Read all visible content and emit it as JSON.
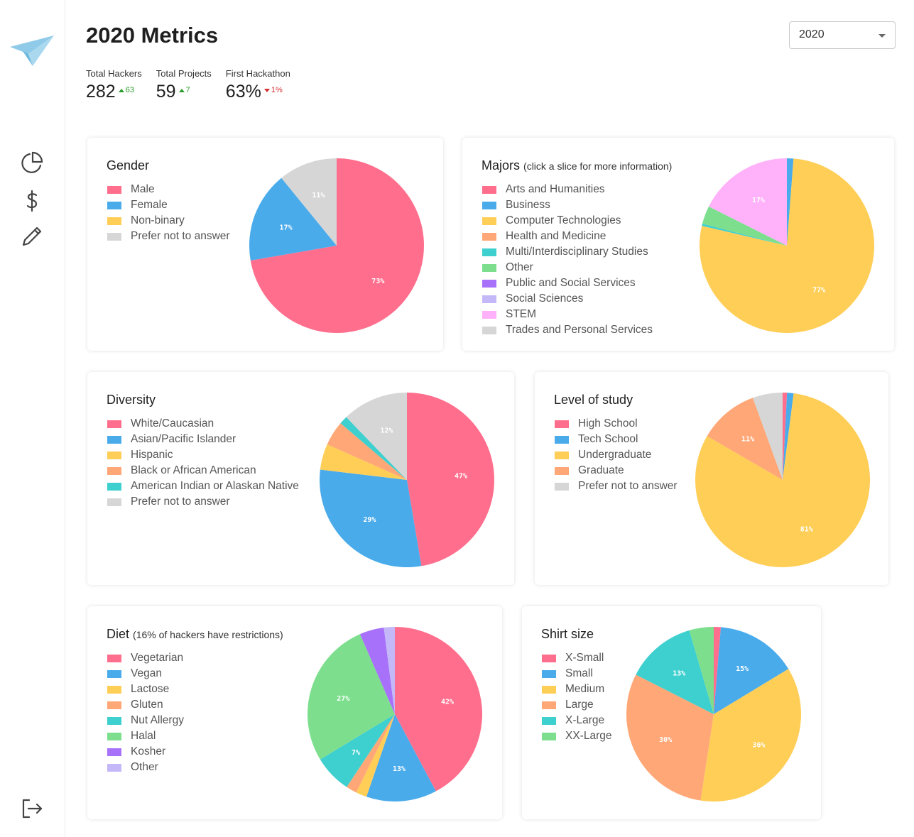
{
  "page": {
    "title": "2020 Metrics"
  },
  "year_select": {
    "value": "2020"
  },
  "stats": [
    {
      "label": "Total Hackers",
      "value": "282",
      "delta": "63",
      "direction": "up"
    },
    {
      "label": "Total Projects",
      "value": "59",
      "delta": "7",
      "direction": "up"
    },
    {
      "label": "First Hackathon",
      "value": "63%",
      "delta": "1%",
      "direction": "down"
    }
  ],
  "colors": {
    "pink": "#ff6f8d",
    "blue": "#4aabeb",
    "yellow": "#ffce57",
    "orange": "#ffa776",
    "teal": "#3ecfcf",
    "green": "#7ddf8d",
    "purple": "#a772f9",
    "lavender": "#c4b8f8",
    "magenta": "#ffb1f9",
    "gray": "#d6d6d6"
  },
  "cards": {
    "gender": {
      "title": "Gender",
      "note": ""
    },
    "majors": {
      "title": "Majors",
      "note": "(click a slice for more information)"
    },
    "diversity": {
      "title": "Diversity",
      "note": ""
    },
    "level": {
      "title": "Level of study",
      "note": ""
    },
    "diet": {
      "title": "Diet",
      "note": "(16% of hackers have restrictions)"
    },
    "shirt": {
      "title": "Shirt size",
      "note": ""
    }
  },
  "chart_data": [
    {
      "id": "gender",
      "type": "pie",
      "labels": [
        "Male",
        "Female",
        "Non-binary",
        "Prefer not to answer"
      ],
      "values": [
        73,
        17,
        0,
        11
      ],
      "colors": [
        "#ff6f8d",
        "#4aabeb",
        "#ffce57",
        "#d6d6d6"
      ],
      "shown_labels": [
        "73%",
        "17%",
        "",
        "11%"
      ]
    },
    {
      "id": "majors",
      "type": "pie",
      "labels": [
        "Arts and Humanities",
        "Business",
        "Computer Technologies",
        "Health and Medicine",
        "Multi/Interdisciplinary Studies",
        "Other",
        "Public and Social Services",
        "Social Sciences",
        "STEM",
        "Trades and Personal Services"
      ],
      "values": [
        0,
        1.2,
        76.5,
        0,
        0.4,
        3.3,
        0,
        0,
        17.4,
        0
      ],
      "colors": [
        "#ff6f8d",
        "#4aabeb",
        "#ffce57",
        "#ffa776",
        "#3ecfcf",
        "#7ddf8d",
        "#a772f9",
        "#c4b8f8",
        "#ffb1f9",
        "#d6d6d6"
      ],
      "shown_labels": [
        "",
        "",
        "77%",
        "",
        "",
        "",
        "",
        "",
        "17%",
        ""
      ]
    },
    {
      "id": "diversity",
      "type": "pie",
      "labels": [
        "White/Caucasian",
        "Asian/Pacific Islander",
        "Hispanic",
        "Black or African American",
        "American Indian or Alaskan Native",
        "Prefer not to answer"
      ],
      "values": [
        46.5,
        29,
        4.7,
        4.5,
        1.5,
        12
      ],
      "colors": [
        "#ff6f8d",
        "#4aabeb",
        "#ffce57",
        "#ffa776",
        "#3ecfcf",
        "#d6d6d6"
      ],
      "shown_labels": [
        "47%",
        "29%",
        "",
        "",
        "",
        "12%"
      ]
    },
    {
      "id": "level",
      "type": "pie",
      "labels": [
        "High School",
        "Tech School",
        "Undergraduate",
        "Graduate",
        "Prefer not to answer"
      ],
      "values": [
        0.8,
        1.2,
        80.7,
        11,
        5.5
      ],
      "colors": [
        "#ff6f8d",
        "#4aabeb",
        "#ffce57",
        "#ffa776",
        "#d6d6d6"
      ],
      "shown_labels": [
        "",
        "",
        "81%",
        "11%",
        ""
      ]
    },
    {
      "id": "diet",
      "type": "pie",
      "labels": [
        "Vegetarian",
        "Vegan",
        "Lactose",
        "Gluten",
        "Nut Allergy",
        "Halal",
        "Kosher",
        "Other"
      ],
      "values": [
        42,
        13,
        2,
        2,
        7,
        27,
        4.5,
        2
      ],
      "colors": [
        "#ff6f8d",
        "#4aabeb",
        "#ffce57",
        "#ffa776",
        "#3ecfcf",
        "#7ddf8d",
        "#a772f9",
        "#c4b8f8"
      ],
      "shown_labels": [
        "42%",
        "13%",
        "",
        "",
        "7%",
        "27%",
        "",
        ""
      ]
    },
    {
      "id": "shirt",
      "type": "pie",
      "labels": [
        "X-Small",
        "Small",
        "Medium",
        "Large",
        "X-Large",
        "XX-Large"
      ],
      "values": [
        1.3,
        15,
        36,
        30,
        13,
        4.5
      ],
      "colors": [
        "#ff6f8d",
        "#4aabeb",
        "#ffce57",
        "#ffa776",
        "#3ecfcf",
        "#7ddf8d"
      ],
      "shown_labels": [
        "",
        "15%",
        "36%",
        "30%",
        "13%",
        ""
      ]
    }
  ]
}
